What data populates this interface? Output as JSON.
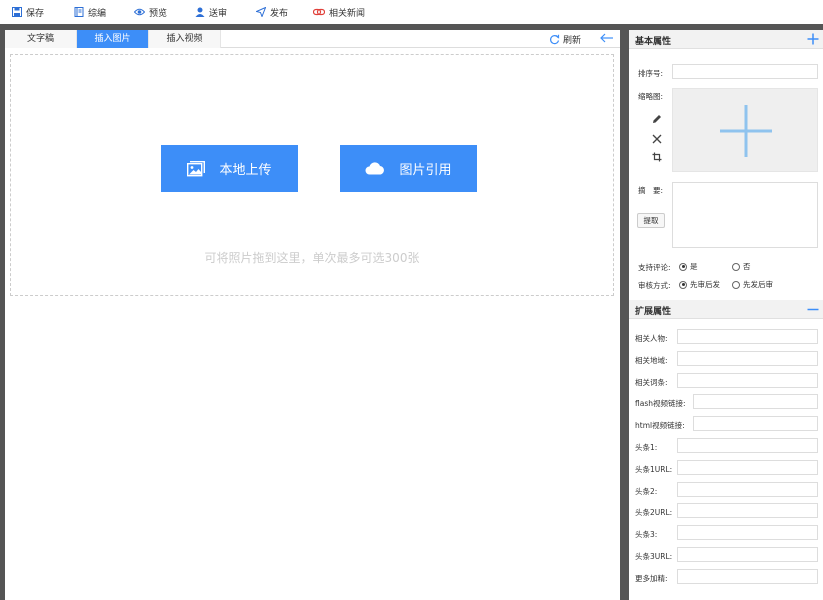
{
  "toolbar": {
    "items": [
      {
        "label": "保存",
        "icon": "save-icon"
      },
      {
        "label": "综编",
        "icon": "book-icon"
      },
      {
        "label": "预览",
        "icon": "eye-icon"
      },
      {
        "label": "送审",
        "icon": "user-icon"
      },
      {
        "label": "发布",
        "icon": "send-icon"
      },
      {
        "label": "相关新闻",
        "icon": "link-icon"
      }
    ]
  },
  "editor": {
    "tabs": [
      "文字稿",
      "插入图片",
      "插入视频"
    ],
    "active_tab": "插入图片",
    "refresh_label": "刷新",
    "upload_local_label": "本地上传",
    "image_ref_label": "图片引用",
    "hint": "可将照片拖到这里，单次最多可选300张"
  },
  "basic": {
    "title": "基本属性",
    "order_label": "排序号:",
    "thumb_label": "缩略图:",
    "summary_label": "摘　要:",
    "extract_label": "提取",
    "comment_label": "支持评论:",
    "comment_yes": "是",
    "comment_no": "否",
    "review_label": "审核方式:",
    "review_a": "先审后发",
    "review_b": "先发后审"
  },
  "extended": {
    "title": "扩展属性",
    "fields": [
      "相关人物:",
      "相关地域:",
      "相关词条:",
      "flash视频链接:",
      "html视频链接:",
      "头条1:",
      "头条1URL:",
      "头条2:",
      "头条2URL:",
      "头条3:",
      "头条3URL:",
      "更多加精:"
    ]
  },
  "colors": {
    "accent": "#3d8ef8",
    "frame": "#555555"
  }
}
